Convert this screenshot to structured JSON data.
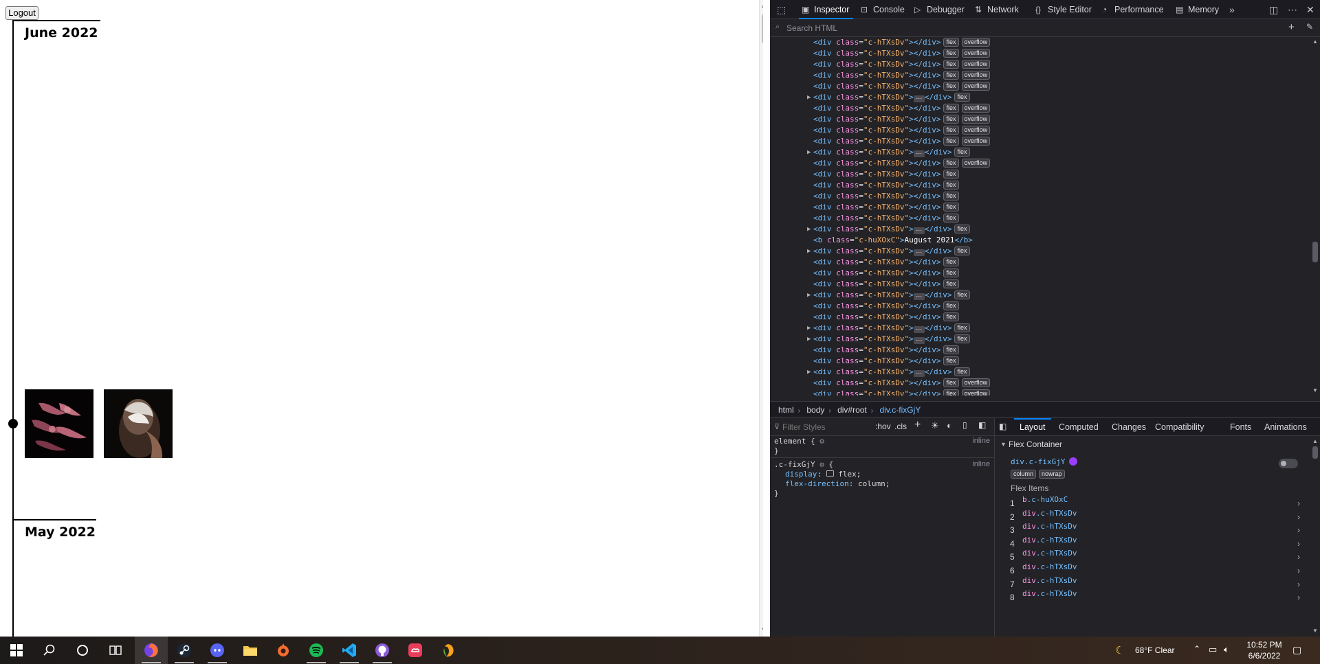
{
  "page": {
    "logout_label": "Logout",
    "months": [
      {
        "label": "June 2022"
      },
      {
        "label": "May 2022"
      }
    ]
  },
  "devtools": {
    "tabs": [
      {
        "label": "Inspector",
        "icon": "inspector-icon",
        "active": true
      },
      {
        "label": "Console",
        "icon": "console-icon"
      },
      {
        "label": "Debugger",
        "icon": "debugger-icon"
      },
      {
        "label": "Network",
        "icon": "network-icon"
      },
      {
        "label": "Style Editor",
        "icon": "style-editor-icon"
      },
      {
        "label": "Performance",
        "icon": "performance-icon"
      },
      {
        "label": "Memory",
        "icon": "memory-icon"
      }
    ],
    "search_placeholder": "Search HTML",
    "markup_rows": [
      {
        "kind": "empty",
        "badges": [
          "flex",
          "overflow"
        ]
      },
      {
        "kind": "empty",
        "badges": [
          "flex",
          "overflow"
        ]
      },
      {
        "kind": "empty",
        "badges": [
          "flex",
          "overflow"
        ]
      },
      {
        "kind": "empty",
        "badges": [
          "flex",
          "overflow"
        ]
      },
      {
        "kind": "empty",
        "badges": [
          "flex",
          "overflow"
        ]
      },
      {
        "kind": "collapsed",
        "badges": [
          "flex"
        ]
      },
      {
        "kind": "empty",
        "badges": [
          "flex",
          "overflow"
        ]
      },
      {
        "kind": "empty",
        "badges": [
          "flex",
          "overflow"
        ]
      },
      {
        "kind": "empty",
        "badges": [
          "flex",
          "overflow"
        ]
      },
      {
        "kind": "empty",
        "badges": [
          "flex",
          "overflow"
        ]
      },
      {
        "kind": "collapsed",
        "badges": [
          "flex"
        ]
      },
      {
        "kind": "empty",
        "badges": [
          "flex",
          "overflow"
        ]
      },
      {
        "kind": "empty",
        "badges": [
          "flex"
        ]
      },
      {
        "kind": "empty",
        "badges": [
          "flex"
        ]
      },
      {
        "kind": "empty",
        "badges": [
          "flex"
        ]
      },
      {
        "kind": "empty",
        "badges": [
          "flex"
        ]
      },
      {
        "kind": "empty",
        "badges": [
          "flex"
        ]
      },
      {
        "kind": "collapsed",
        "badges": [
          "flex"
        ]
      },
      {
        "kind": "b",
        "text": "August 2021"
      },
      {
        "kind": "collapsed",
        "badges": [
          "flex"
        ]
      },
      {
        "kind": "empty",
        "badges": [
          "flex"
        ]
      },
      {
        "kind": "empty",
        "badges": [
          "flex"
        ]
      },
      {
        "kind": "empty",
        "badges": [
          "flex"
        ]
      },
      {
        "kind": "collapsed",
        "badges": [
          "flex"
        ]
      },
      {
        "kind": "empty",
        "badges": [
          "flex"
        ]
      },
      {
        "kind": "empty",
        "badges": [
          "flex"
        ]
      },
      {
        "kind": "collapsed",
        "badges": [
          "flex"
        ]
      },
      {
        "kind": "collapsed",
        "badges": [
          "flex"
        ]
      },
      {
        "kind": "empty",
        "badges": [
          "flex"
        ]
      },
      {
        "kind": "empty",
        "badges": [
          "flex"
        ]
      },
      {
        "kind": "collapsed",
        "badges": [
          "flex"
        ]
      },
      {
        "kind": "empty",
        "badges": [
          "flex",
          "overflow"
        ]
      },
      {
        "kind": "empty",
        "badges": [
          "flex",
          "overflow"
        ]
      }
    ],
    "div_class": "c-hTXsDv",
    "b_class": "c-huXOxC",
    "breadcrumbs": [
      "html",
      "body",
      "div#root",
      "div.c-fixGjY"
    ],
    "filter_placeholder": "Filter Styles",
    "hov_label": ":hov",
    "cls_label": ".cls",
    "rules": {
      "element_selector": "element {",
      "element_close": "}",
      "inline_label": "inline",
      "class_selector": ".c-fixGjY",
      "open_brace": "{",
      "close_brace": "}",
      "decl1_prop": "display",
      "decl1_val": "flex;",
      "decl2_prop": "flex-direction",
      "decl2_val": "column;"
    },
    "side_tabs": [
      "Layout",
      "Computed",
      "Changes",
      "Compatibility",
      "Fonts",
      "Animations"
    ],
    "layout": {
      "section_title": "Flex Container",
      "container_name": "div.c-fixGjY",
      "container_badges": [
        "column",
        "nowrap"
      ],
      "items_title": "Flex Items",
      "items": [
        {
          "num": "1",
          "name": "b.c-huXOxC"
        },
        {
          "num": "2",
          "name": "div.c-hTXsDv"
        },
        {
          "num": "3",
          "name": "div.c-hTXsDv"
        },
        {
          "num": "4",
          "name": "div.c-hTXsDv"
        },
        {
          "num": "5",
          "name": "div.c-hTXsDv"
        },
        {
          "num": "6",
          "name": "div.c-hTXsDv"
        },
        {
          "num": "7",
          "name": "div.c-hTXsDv"
        },
        {
          "num": "8",
          "name": "div.c-hTXsDv"
        }
      ]
    }
  },
  "taskbar": {
    "apps": [
      "windows-start-icon",
      "search-icon",
      "cortana-icon",
      "task-view-icon",
      "firefox-icon",
      "steam-icon",
      "discord-icon",
      "file-explorer-icon",
      "origin-icon",
      "spotify-icon",
      "vscode-icon",
      "github-desktop-icon",
      "creative-cloud-icon",
      "fl-studio-icon"
    ],
    "weather": "68°F  Clear",
    "time": "10:52 PM",
    "date": "6/6/2022"
  },
  "colors": {
    "devtools_bg": "#232327",
    "accent": "#0a84ff",
    "tag": "#75bfff",
    "attr": "#ff97e8",
    "value": "#f9b36b"
  }
}
